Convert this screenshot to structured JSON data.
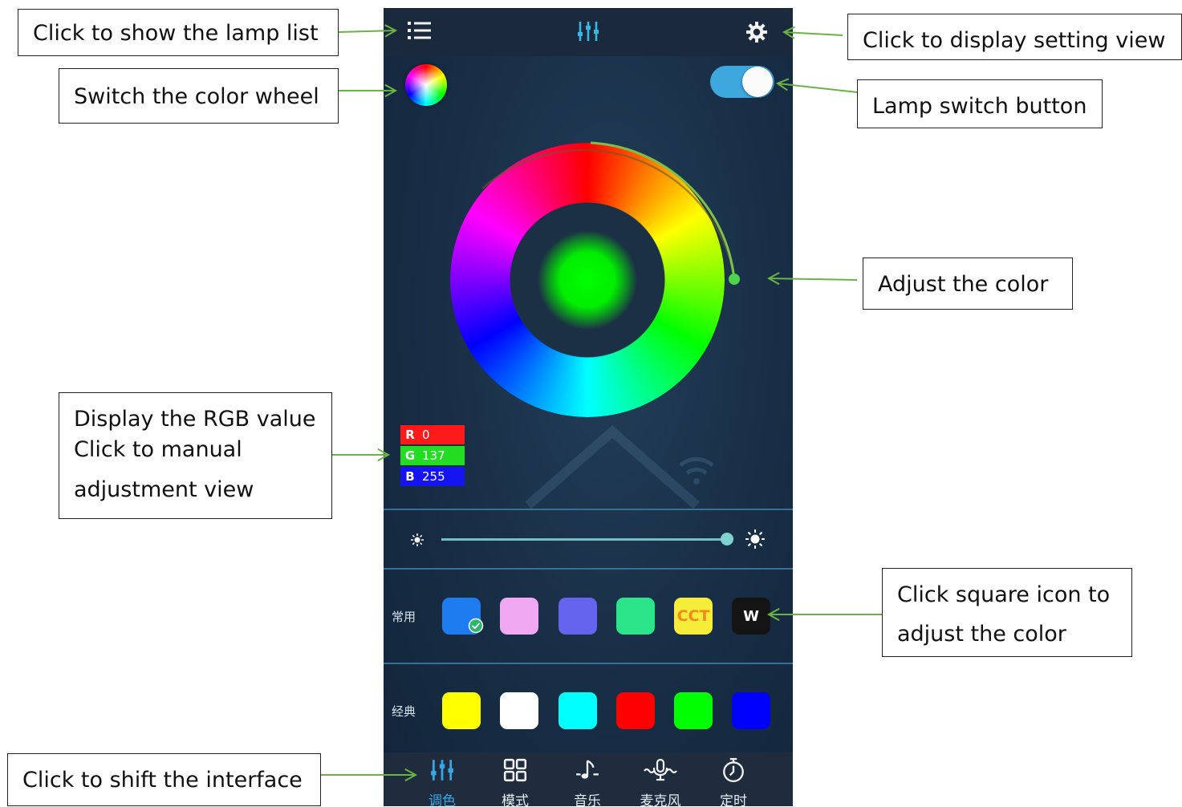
{
  "annotations": {
    "lamp_list": "Click to show the lamp list",
    "setting_view": "Click to display setting view",
    "color_wheel": "Switch the color wheel",
    "lamp_switch": "Lamp switch button",
    "adjust_color": "Adjust the color",
    "rgb_lines": [
      "Display the RGB value",
      "Click to manual",
      "adjustment view"
    ],
    "square_lines": [
      "Click square icon to",
      "adjust the color"
    ],
    "shift_interface": "Click to shift the interface"
  },
  "header": {
    "left_icon": "list-icon",
    "center_icon": "equalizer-icon",
    "right_icon": "gear-icon"
  },
  "power_switch": {
    "state": "on",
    "color": "#3ea8de"
  },
  "wheel": {
    "selected_color": "#00ff00"
  },
  "rgb": {
    "r_label": "R",
    "r_value": "0",
    "g_label": "G",
    "g_value": "137",
    "b_label": "B",
    "b_value": "255",
    "r_color": "#ff1a1a",
    "g_color": "#22dd22",
    "b_color": "#1414f0"
  },
  "brightness": {
    "level_percent": 100,
    "min_icon": "sun-small-icon",
    "max_icon": "sun-large-icon"
  },
  "common": {
    "label": "常用",
    "swatches": [
      {
        "color": "#1e7bf0",
        "text": "",
        "selected": true
      },
      {
        "color": "#f0a8f2",
        "text": ""
      },
      {
        "color": "#6464ee",
        "text": ""
      },
      {
        "color": "#2ce48a",
        "text": ""
      },
      {
        "color": "#f6ec3a",
        "text": "CCT",
        "text_color": "#f08a1c"
      },
      {
        "color": "#141414",
        "text": "W",
        "text_color": "#ffffff"
      }
    ]
  },
  "classic": {
    "label": "经典",
    "swatches": [
      {
        "color": "#ffff00"
      },
      {
        "color": "#ffffff"
      },
      {
        "color": "#00ffff"
      },
      {
        "color": "#ff0000"
      },
      {
        "color": "#00ff00"
      },
      {
        "color": "#0000ff"
      }
    ]
  },
  "tabs": [
    {
      "label": "调色",
      "icon": "equalizer-icon",
      "active": true
    },
    {
      "label": "模式",
      "icon": "grid-icon",
      "active": false
    },
    {
      "label": "音乐",
      "icon": "music-note-icon",
      "active": false
    },
    {
      "label": "麦克风",
      "icon": "microphone-icon",
      "active": false
    },
    {
      "label": "定时",
      "icon": "timer-icon",
      "active": false
    }
  ],
  "accent_color": "#3aa6e6",
  "arrow_color": "#6bb344"
}
